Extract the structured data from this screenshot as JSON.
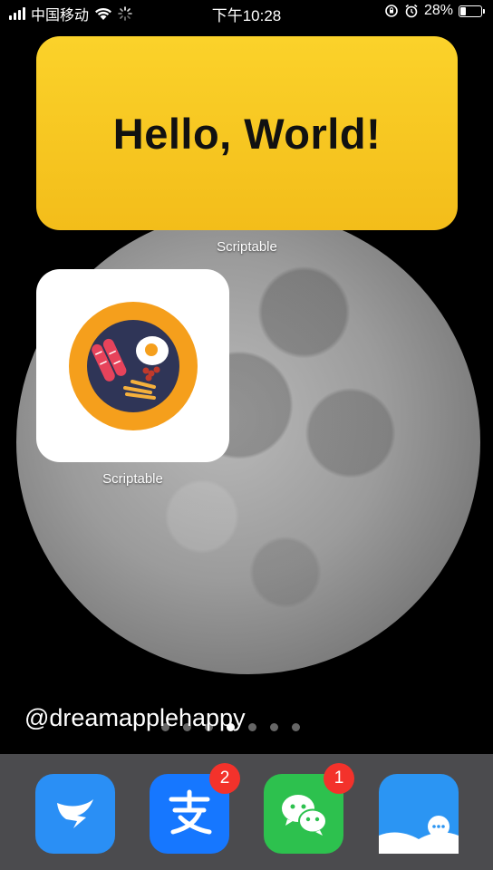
{
  "status_bar": {
    "carrier": "中国移动",
    "time": "下午10:28",
    "battery_percent": "28%",
    "battery_level": 0.28,
    "icons": [
      "signal-icon",
      "wifi-icon",
      "loading-icon",
      "rotation-lock-icon",
      "alarm-icon",
      "battery-icon"
    ]
  },
  "widgets": {
    "large": {
      "text": "Hello, World!",
      "label": "Scriptable",
      "color": "#f8c820"
    },
    "small": {
      "label": "Scriptable",
      "image": "food-plate-icon"
    }
  },
  "watermark": "@dreamapplehappy",
  "page_dots": {
    "count": 7,
    "active_index": 3
  },
  "dock": {
    "apps": [
      {
        "name": "dingtalk",
        "icon": "dingtalk-icon",
        "color": "#2a8ff5",
        "badge": ""
      },
      {
        "name": "alipay",
        "icon": "alipay-icon",
        "color": "#1677ff",
        "badge": "2"
      },
      {
        "name": "wechat",
        "icon": "wechat-icon",
        "color": "#2dc14e",
        "badge": "1"
      },
      {
        "name": "reader",
        "icon": "reader-icon",
        "color": "#2b95f3",
        "badge": ""
      }
    ]
  },
  "colors": {
    "badge": "#f3322b",
    "dock_bg": "#4b4b4e"
  }
}
